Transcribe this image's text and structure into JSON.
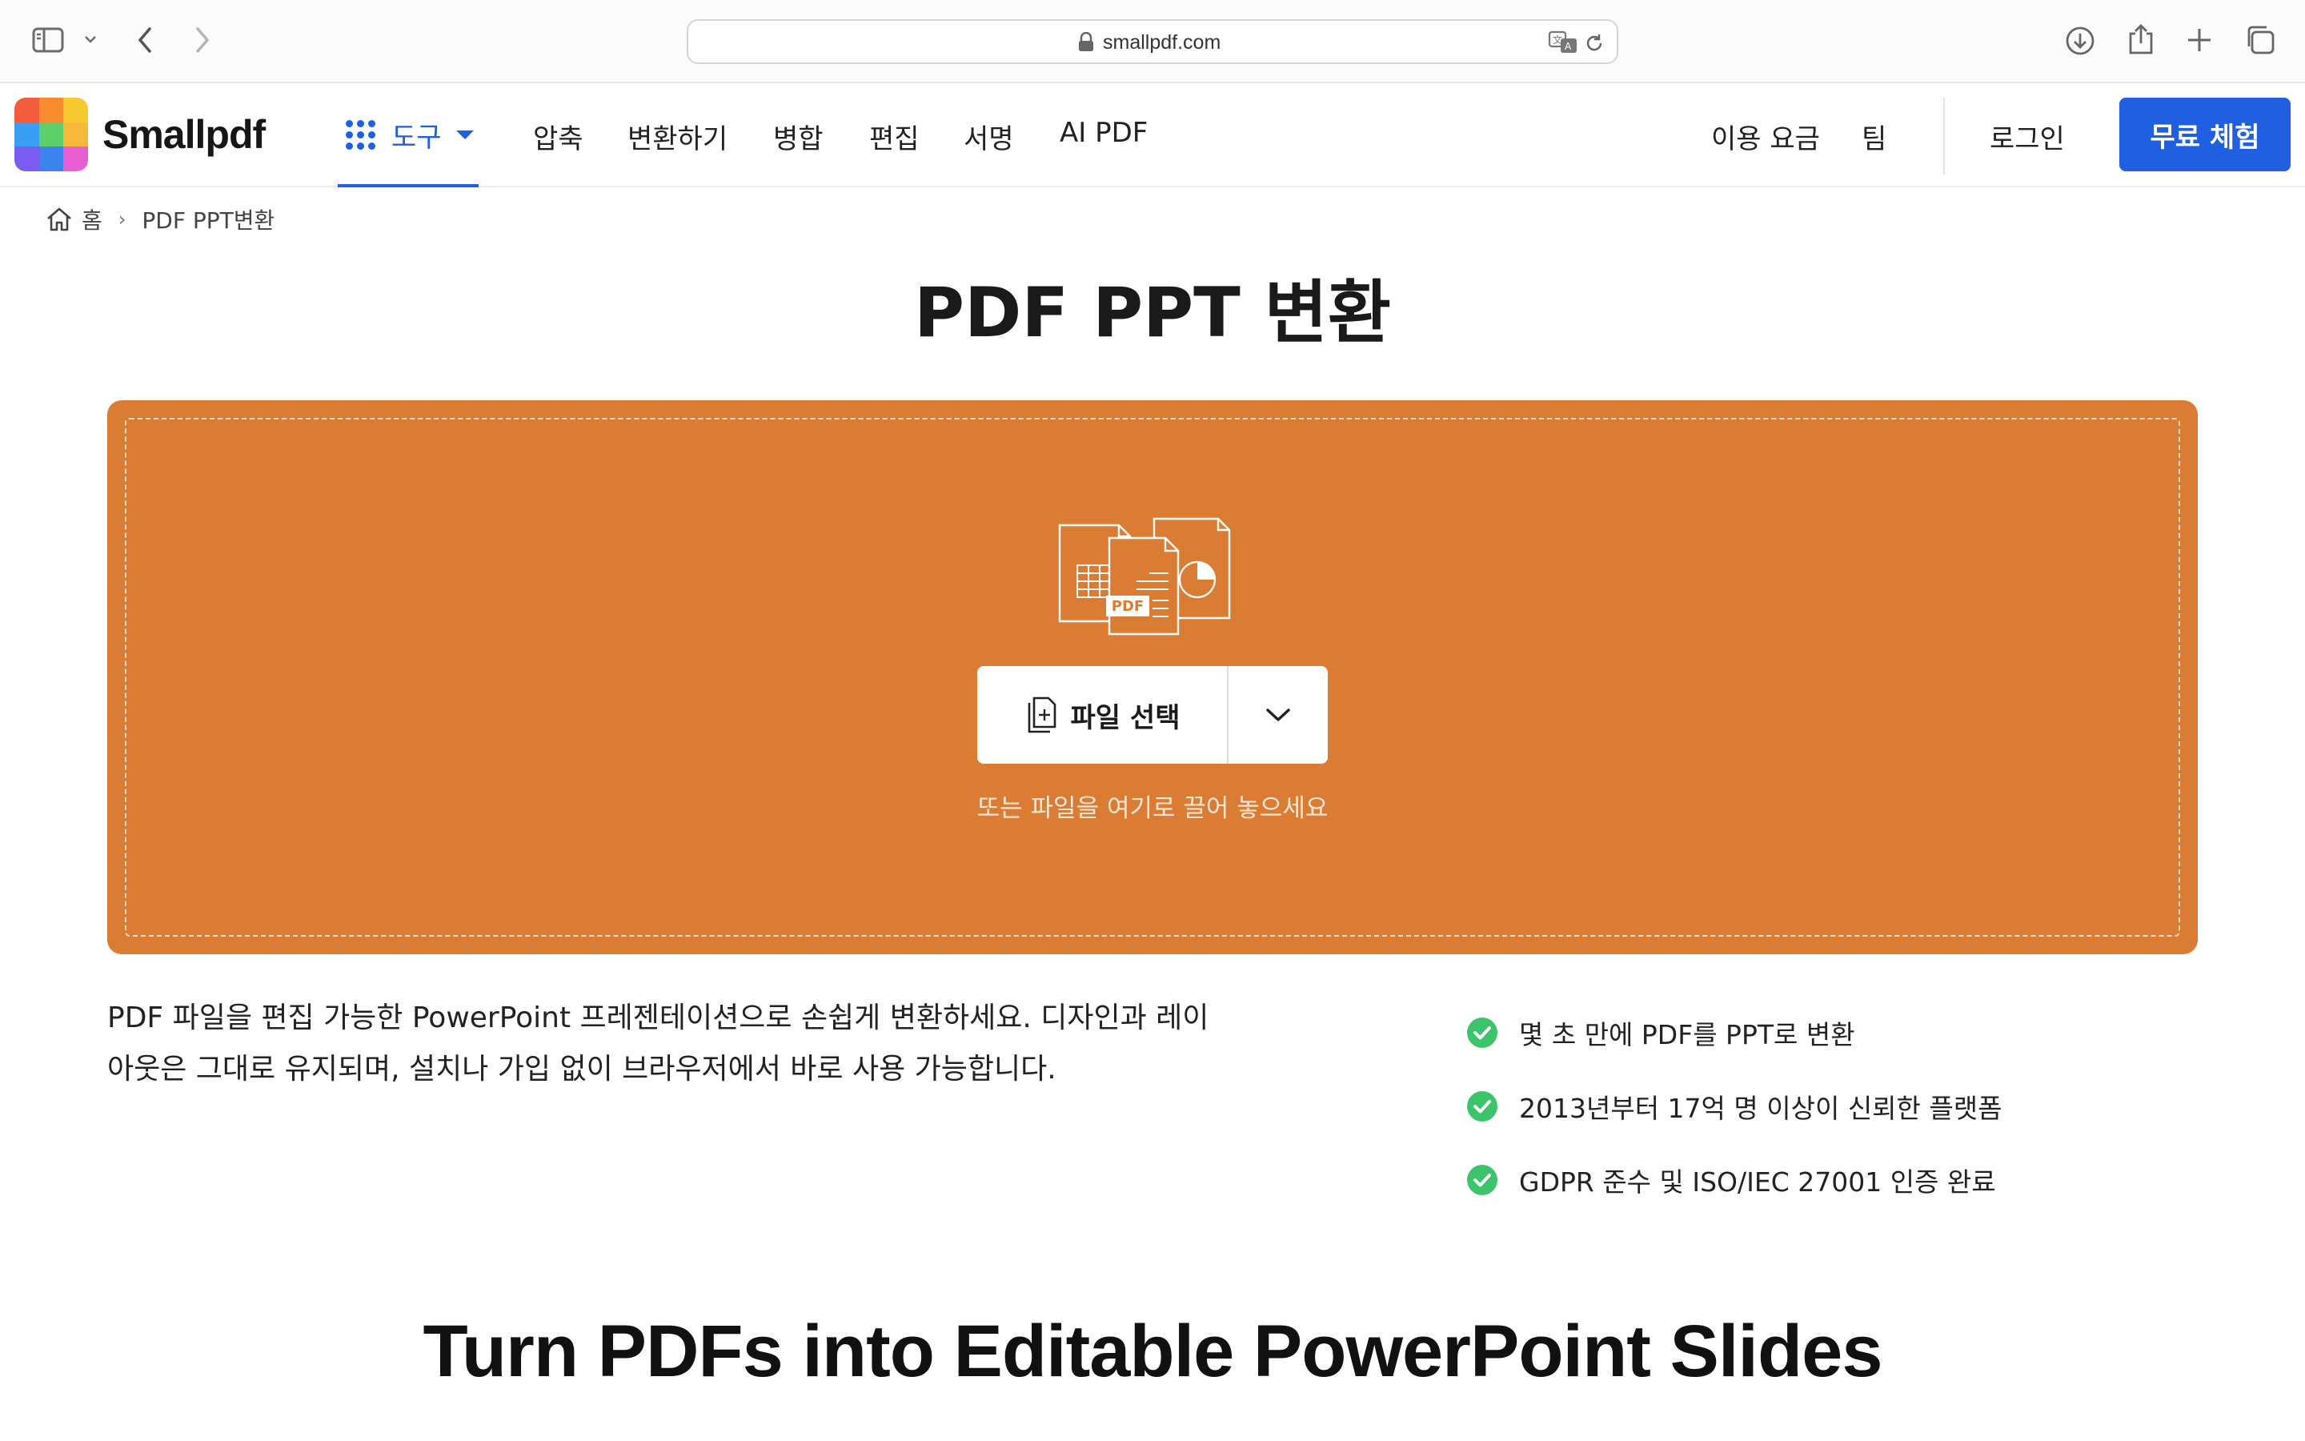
{
  "browser": {
    "url": "smallpdf.com"
  },
  "header": {
    "logo_text": "Smallpdf",
    "logo_colors": [
      "#f25c3b",
      "#f78b2e",
      "#f6c932",
      "#3a9ef5",
      "#5dd06a",
      "#f7b93a",
      "#7a5cf0",
      "#3c83f0",
      "#e75fd3"
    ],
    "tools_label": "도구",
    "nav": [
      "압축",
      "변환하기",
      "병합",
      "편집",
      "서명",
      "AI PDF"
    ],
    "pricing": "이용 요금",
    "team": "팀",
    "login": "로그인",
    "cta": "무료 체험",
    "accent": "#1f5fe0"
  },
  "breadcrumb": {
    "home": "홈",
    "current": "PDF PPT변환"
  },
  "main": {
    "title": "PDF PPT 변환",
    "dropzone_color": "#da7c33",
    "illustration_badge": "PDF",
    "choose_file": "파일 선택",
    "drop_hint": "또는 파일을 여기로 끌어 놓으세요",
    "description_line1": "PDF 파일을 편집 가능한 PowerPoint 프레젠테이션으로 손쉽게 변환하세요. 디자인과 레이",
    "description_line2": "아웃은 그대로 유지되며, 설치나 가입 없이 브라우저에서 바로 사용 가능합니다.",
    "features": [
      "몇 초 만에 PDF를 PPT로 변환",
      "2013년부터 17억 명 이상이 신뢰한 플랫폼",
      "GDPR 준수 및 ISO/IEC 27001 인증 완료"
    ],
    "check_color": "#3cc46a",
    "headline": "Turn PDFs into Editable PowerPoint Slides"
  }
}
